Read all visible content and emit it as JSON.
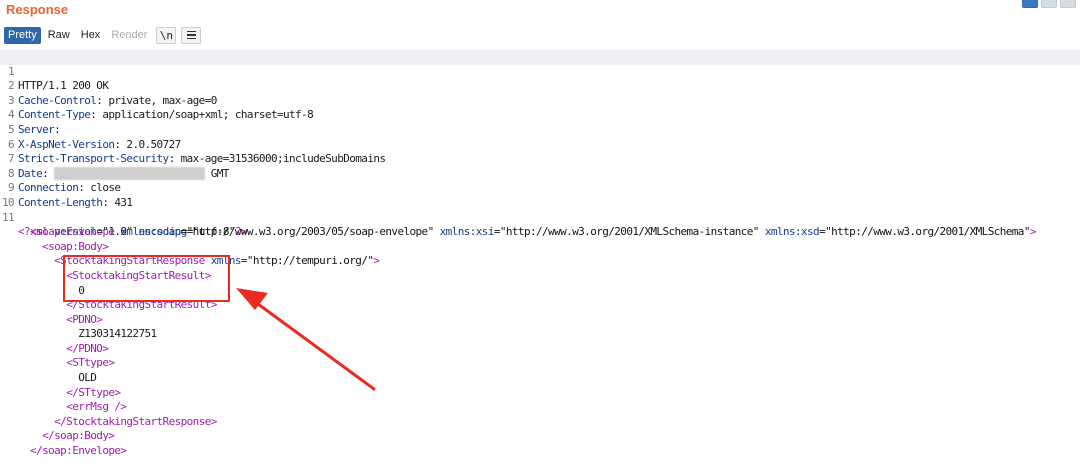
{
  "panel": {
    "title": "Response",
    "tabs": [
      "Pretty",
      "Raw",
      "Hex",
      "Render"
    ],
    "newline_button": "\\n",
    "layout_icons": [
      "split-horizontal-icon",
      "split-vertical-icon",
      "single-pane-icon"
    ]
  },
  "lines": {
    "n1": "1",
    "n2": "2",
    "n3": "3",
    "n4": "4",
    "n5": "5",
    "n6": "6",
    "n7": "7",
    "n8": "8",
    "n9": "9",
    "n10": "10",
    "n11": "11",
    "status": "HTTP/1.1 200 OK",
    "h2k": "Cache-Control",
    "h2v": ": private, max-age=0",
    "h3k": "Content-Type",
    "h3v": ": application/soap+xml; charset=utf-8",
    "h4k": "Server",
    "h4v": ":",
    "h5k": "X-AspNet-Version",
    "h5v": ": 2.0.50727",
    "h6k": "Strict-Transport-Security",
    "h6v": ": max-age=31536000;includeSubDomains",
    "h7k": "Date",
    "h7v": ":",
    "h7tail": "GMT",
    "h8k": "Connection",
    "h8v": ": close",
    "h9k": "Content-Length",
    "h9v": ": 431",
    "xmldecl_open": "<?xml",
    "xmldecl_a1": "version",
    "xmldecl_v1": "=\"1.0\"",
    "xmldecl_a2": "encoding",
    "xmldecl_v2": "=\"utf-8\"",
    "xmldecl_close": "?>",
    "env_open": "<soap:Envelope",
    "env_a1": "xmlns:soap",
    "env_v1": "=\"http://www.w3.org/2003/05/soap-envelope\"",
    "env_a2": "xmlns:xsi",
    "env_v2": "=\"http://www.w3.org/2001/XMLSchema-instance\"",
    "env_a3": "xmlns:xsd",
    "env_v3": "=\"http://www.w3.org/2001/XMLSchema\"",
    "env_close": ">",
    "body_open": "<soap:Body>",
    "resp_open": "<StocktakingStartResponse",
    "resp_a1": "xmlns",
    "resp_v1": "=\"http://tempuri.org/\"",
    "resp_close": ">",
    "result_open": "<StocktakingStartResult>",
    "result_val": "0",
    "result_close": "</StocktakingStartResult>",
    "pdno_open": "<PDNO>",
    "pdno_val": "Z130314122751",
    "pdno_close": "</PDNO>",
    "sttype_open": "<STtype>",
    "sttype_val": "OLD",
    "sttype_close": "</STtype>",
    "errmsg": "<errMsg />",
    "resp_end": "</StocktakingStartResponse>",
    "body_end": "</soap:Body>",
    "env_end": "</soap:Envelope>"
  },
  "colors": {
    "title": "#e8662e",
    "active_tab": "#2f67a8",
    "header_key": "#123b8f",
    "xml_tag": "#a11bb0",
    "annotation": "#ea2b22"
  }
}
